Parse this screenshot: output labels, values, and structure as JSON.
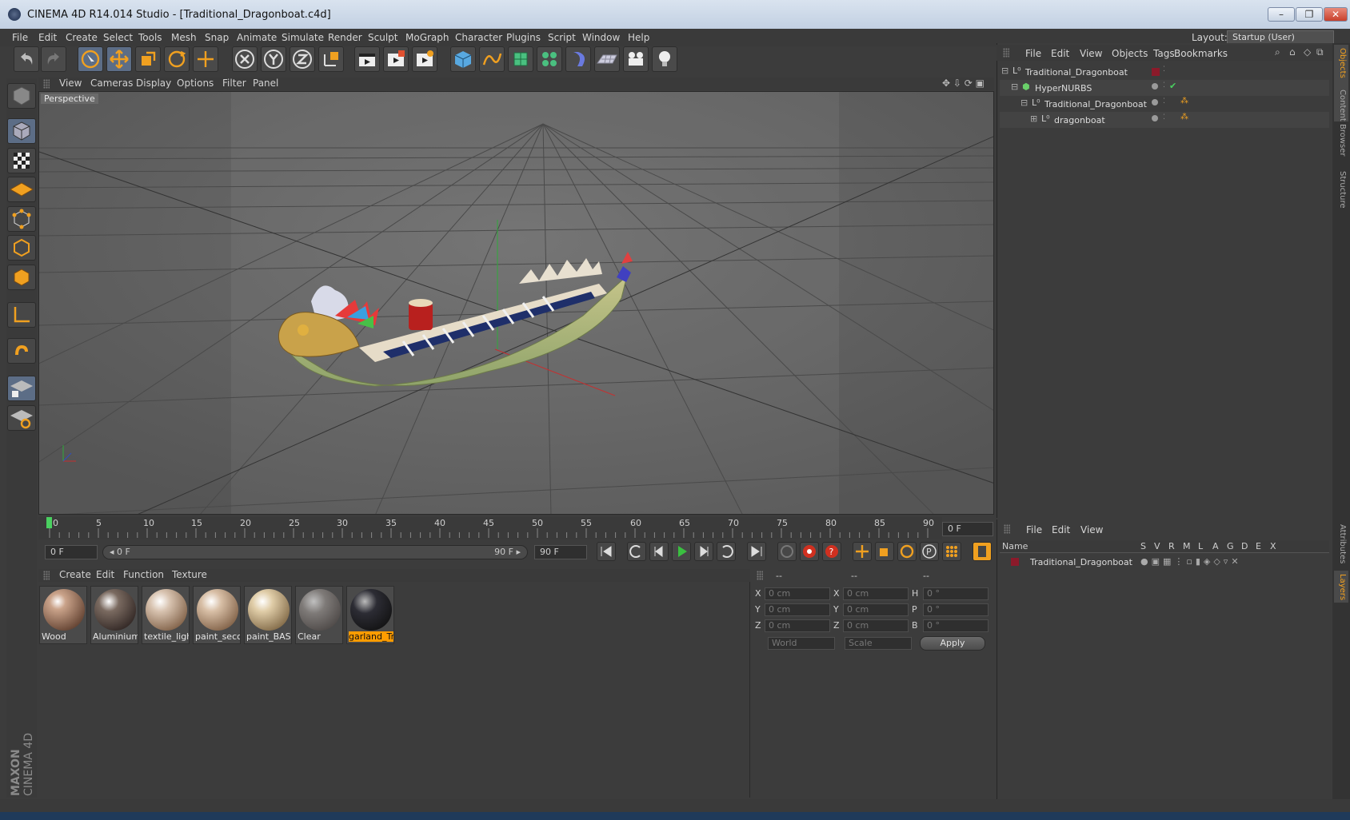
{
  "window": {
    "title": "CINEMA 4D R14.014 Studio - [Traditional_Dragonboat.c4d]",
    "min": "–",
    "restore": "❐",
    "close": "✕"
  },
  "menubar": [
    "File",
    "Edit",
    "Create",
    "Select",
    "Tools",
    "Mesh",
    "Snap",
    "Animate",
    "Simulate",
    "Render",
    "Sculpt",
    "MoGraph",
    "Character",
    "Plugins",
    "Script",
    "Window",
    "Help"
  ],
  "layout": {
    "label": "Layout:",
    "value": "Startup (User)"
  },
  "viewport": {
    "menus": [
      "View",
      "Cameras",
      "Display",
      "Options",
      "Filter",
      "Panel"
    ],
    "label": "Perspective"
  },
  "timeline": {
    "ticks": [
      "0",
      "5",
      "10",
      "15",
      "20",
      "25",
      "30",
      "35",
      "40",
      "45",
      "50",
      "55",
      "60",
      "65",
      "70",
      "75",
      "80",
      "85",
      "90"
    ],
    "current_frame": "0 F",
    "start_field": "0 F",
    "range_start": "◂ 0 F",
    "range_end": "90 F ▸",
    "end_field": "90 F"
  },
  "materials": {
    "menus": [
      "Create",
      "Edit",
      "Function",
      "Texture"
    ],
    "items": [
      {
        "label": "Wood",
        "color": "#caa38a"
      },
      {
        "label": "Aluminium",
        "color": "#7a6a60"
      },
      {
        "label": "textile_ligh",
        "color": "#d8c3b0"
      },
      {
        "label": "paint_seco",
        "color": "#d8bfa6"
      },
      {
        "label": "paint_BASI",
        "color": "#e0cda8"
      },
      {
        "label": "Clear",
        "color": "#8b8683"
      },
      {
        "label": "garland_Tr",
        "color": "#2c2c34"
      }
    ],
    "selected": "garland_Tr"
  },
  "coords": {
    "headers": [
      "--",
      "--",
      "--"
    ],
    "rows": [
      {
        "a": "X",
        "a_val": "0 cm",
        "b": "X",
        "b_val": "0 cm",
        "c": "H",
        "c_val": "0 °"
      },
      {
        "a": "Y",
        "a_val": "0 cm",
        "b": "Y",
        "b_val": "0 cm",
        "c": "P",
        "c_val": "0 °"
      },
      {
        "a": "Z",
        "a_val": "0 cm",
        "b": "Z",
        "b_val": "0 cm",
        "c": "B",
        "c_val": "0 °"
      }
    ],
    "mode": "World",
    "type": "Scale",
    "apply": "Apply"
  },
  "objects": {
    "menus": [
      "File",
      "Edit",
      "View",
      "Objects",
      "Tags",
      "Bookmarks"
    ],
    "rows": [
      {
        "name": "Traditional_Dragonboat"
      },
      {
        "name": "HyperNURBS"
      },
      {
        "name": "Traditional_Dragonboat"
      },
      {
        "name": "dragonboat"
      }
    ]
  },
  "layers": {
    "menus": [
      "File",
      "Edit",
      "View"
    ],
    "columns": [
      "Name",
      "S",
      "V",
      "R",
      "M",
      "L",
      "A",
      "G",
      "D",
      "E",
      "X"
    ],
    "row": "Traditional_Dragonboat"
  },
  "side_tabs": [
    "Objects",
    "Content Browser",
    "Structure",
    "Attributes",
    "Layers"
  ],
  "branding": {
    "line1": "MAXON",
    "line2": "CINEMA 4D"
  },
  "colors": {
    "accent": "#ff9c00",
    "selected_tool": "#5c6d86",
    "layer_color": "#8b1a2a"
  }
}
